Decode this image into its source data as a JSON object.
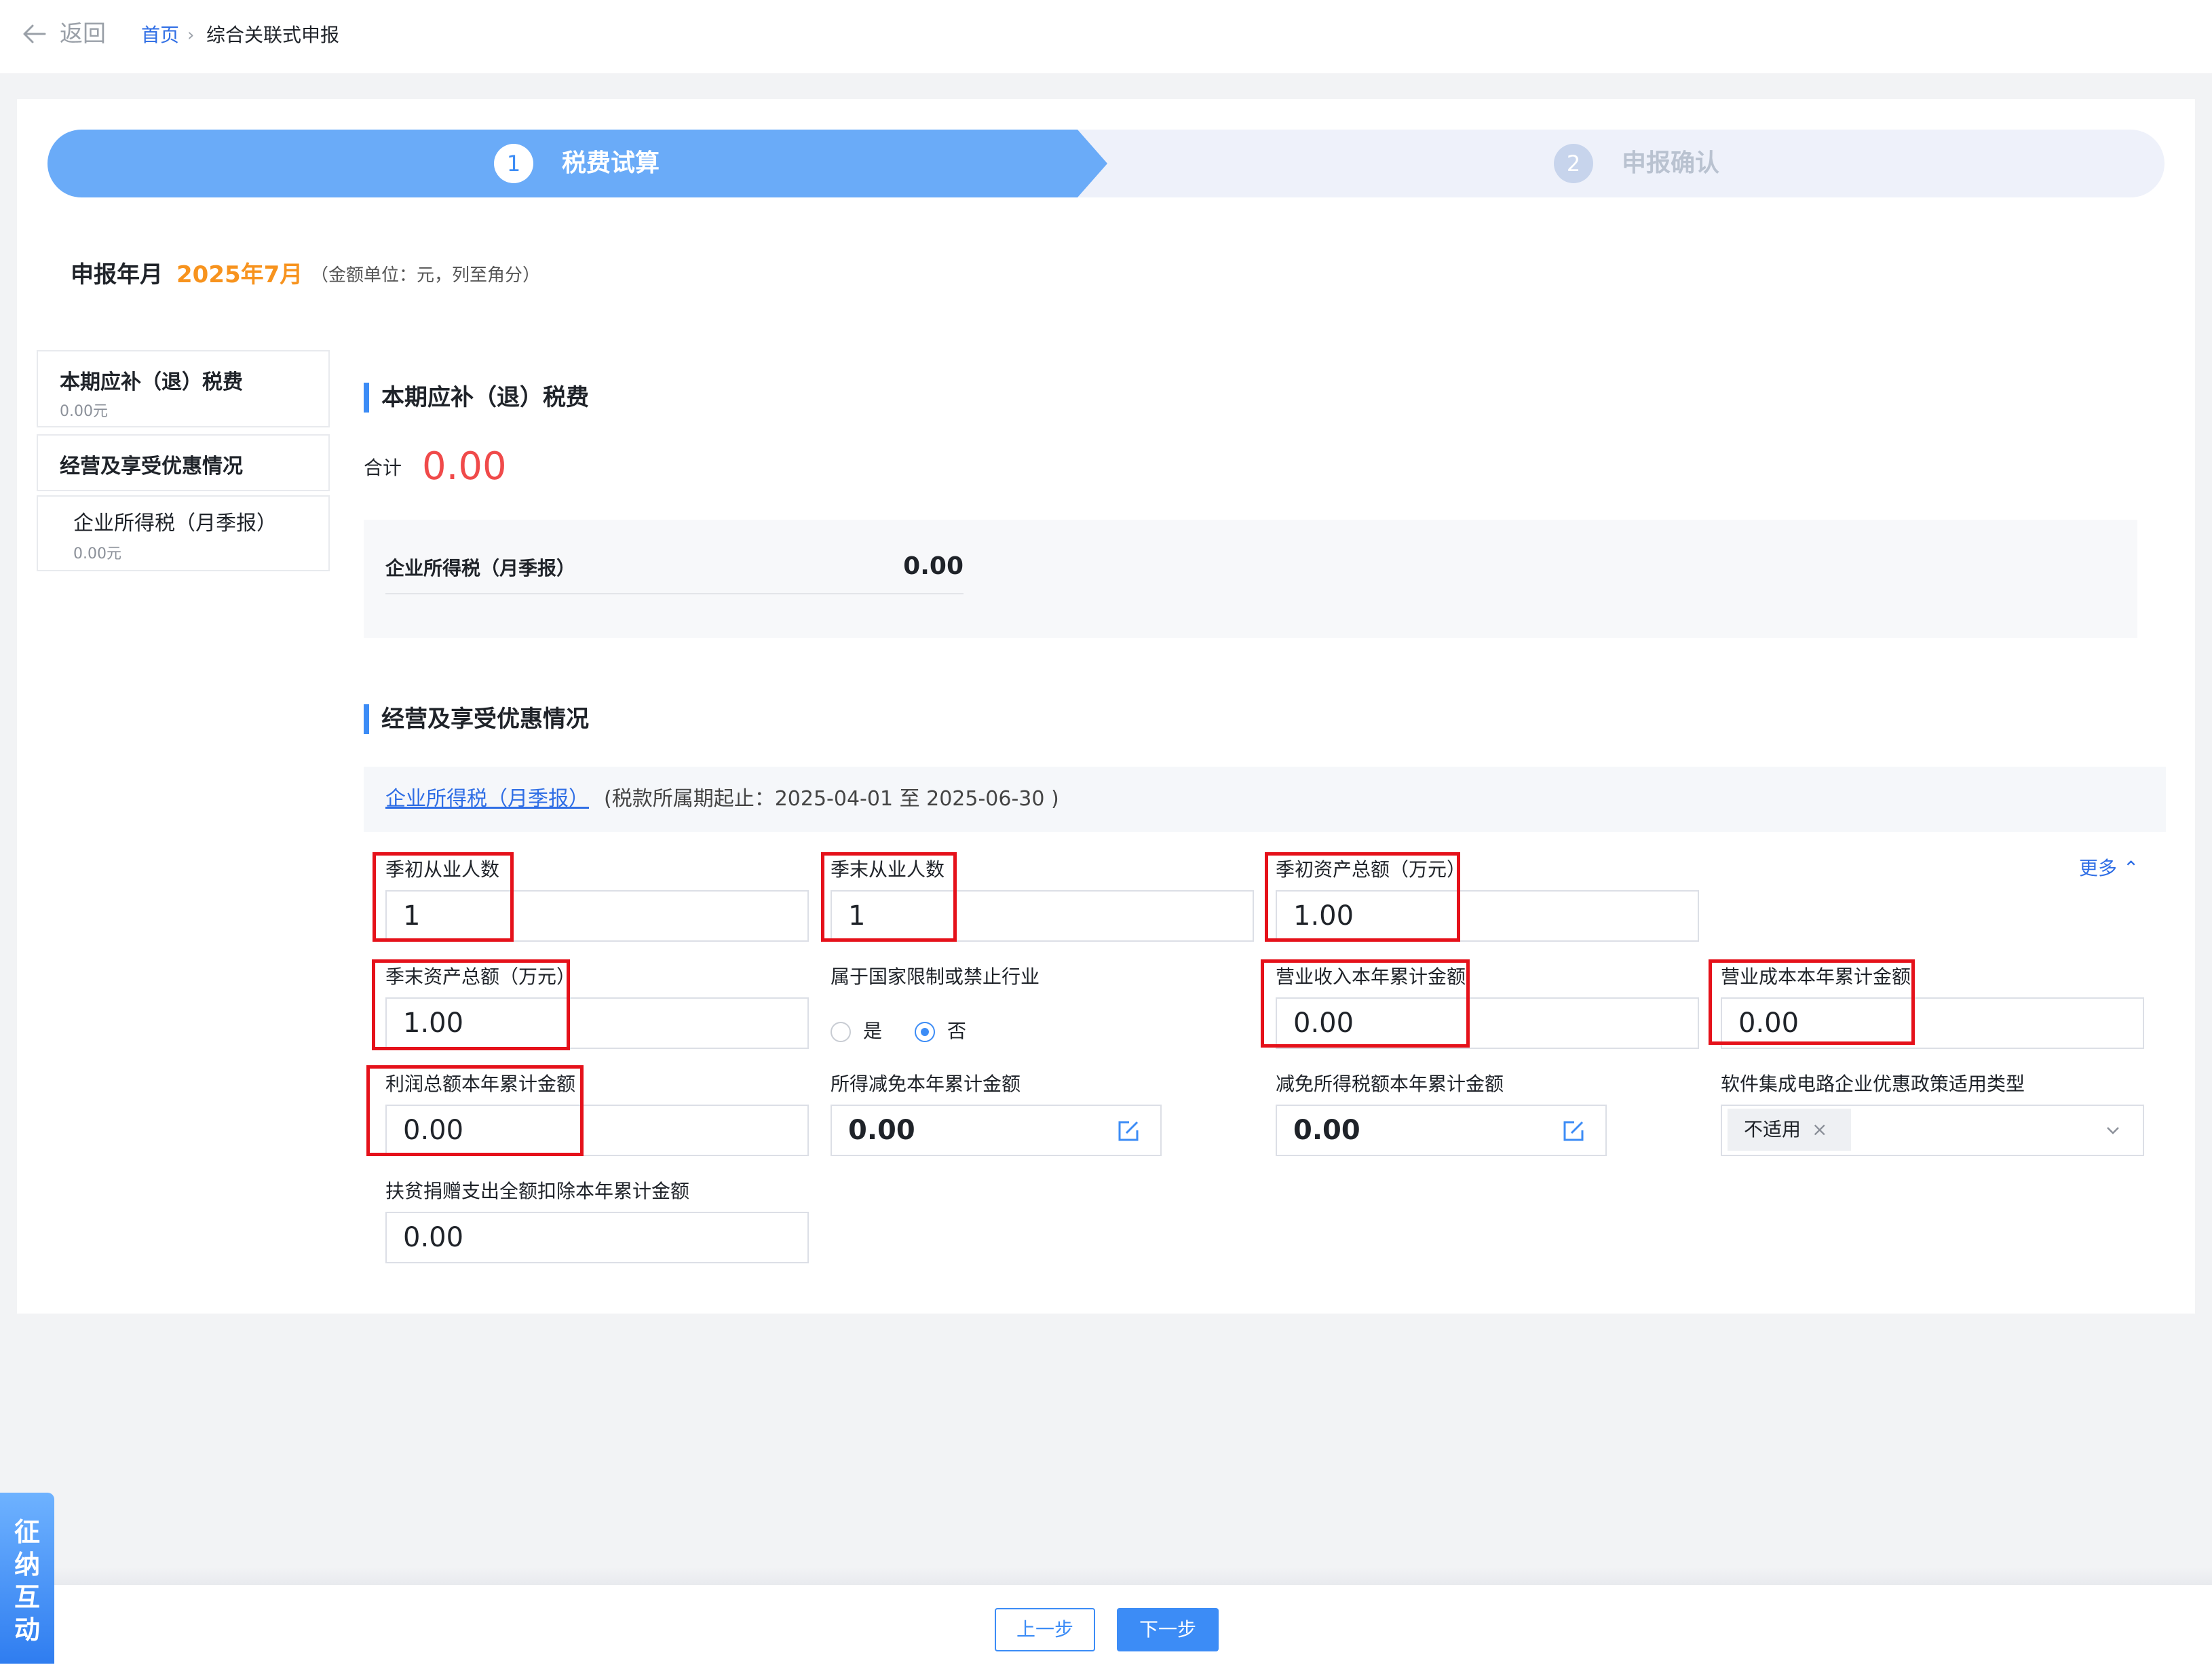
{
  "header": {
    "back_label": "返回",
    "breadcrumb_home": "首页",
    "breadcrumb_sep": "›",
    "breadcrumb_current": "综合关联式申报"
  },
  "steps": [
    {
      "num": "1",
      "label": "税费试算",
      "active": true
    },
    {
      "num": "2",
      "label": "申报确认",
      "active": false
    }
  ],
  "period": {
    "label": "申报年月",
    "value": "2025年7月",
    "note": "（金额单位：元，列至角分）"
  },
  "side_menu": [
    {
      "title": "本期应补（退）税费",
      "sub": "0.00元"
    },
    {
      "title": "经营及享受优惠情况"
    },
    {
      "title": "企业所得税（月季报）",
      "sub": "0.00元"
    }
  ],
  "section1": {
    "title": "本期应补（退）税费",
    "total_label": "合计",
    "total_value": "0.00",
    "tax_name": "企业所得税（月季报）",
    "tax_value": "0.00"
  },
  "section2": {
    "title": "经营及享受优惠情况",
    "link": "企业所得税（月季报）",
    "period_note": "(税款所属期起止：2025-04-01 至 2025-06-30 )",
    "more": "更多 ⌃"
  },
  "fields": {
    "f1": {
      "label": "季初从业人数",
      "value": "1"
    },
    "f2": {
      "label": "季末从业人数",
      "value": "1"
    },
    "f3": {
      "label": "季初资产总额（万元）",
      "value": "1.00"
    },
    "f4": {
      "label": "季末资产总额（万元）",
      "value": "1.00"
    },
    "f5": {
      "label": "属于国家限制或禁止行业",
      "opt_yes": "是",
      "opt_no": "否",
      "selected": "否"
    },
    "f6": {
      "label": "营业收入本年累计金额",
      "value": "0.00"
    },
    "f7": {
      "label": "营业成本本年累计金额",
      "value": "0.00"
    },
    "f8": {
      "label": "利润总额本年累计金额",
      "value": "0.00"
    },
    "f9": {
      "label": "所得减免本年累计金额",
      "value": "0.00"
    },
    "f10": {
      "label": "减免所得税额本年累计金额",
      "value": "0.00"
    },
    "f11": {
      "label": "软件集成电路企业优惠政策适用类型",
      "value": "不适用",
      "clear": "×"
    },
    "f12": {
      "label": "扶贫捐赠支出全额扣除本年累计金额",
      "value": "0.00"
    }
  },
  "footer": {
    "prev": "上一步",
    "next": "下一步"
  },
  "float_tab": [
    "征",
    "纳",
    "互",
    "动"
  ],
  "colors": {
    "accent": "#3c8cf6",
    "link": "#2f6ee5",
    "period_highlight": "#f7931e",
    "total_red": "#f04a4a",
    "annotation_red": "#e5111a"
  }
}
